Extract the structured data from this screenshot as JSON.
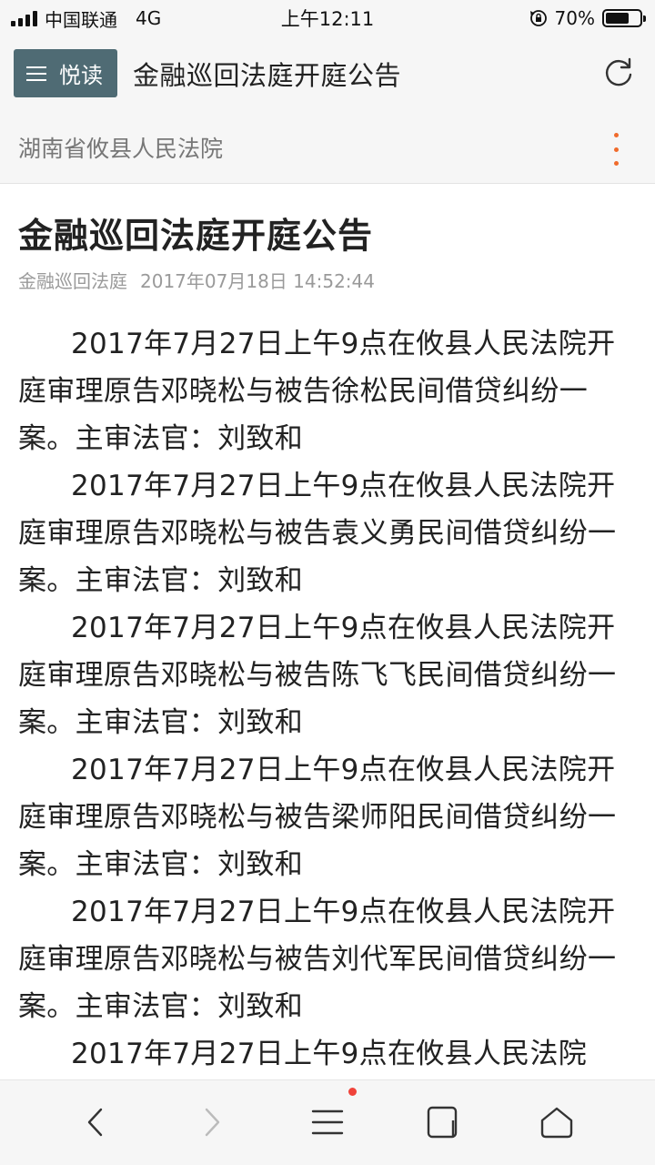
{
  "status_bar": {
    "carrier": "中国联通",
    "network": "4G",
    "time": "上午12:11",
    "battery_percent": "70%",
    "battery_level": 0.7,
    "icons": [
      "signal-icon",
      "rotation-lock-icon",
      "battery-icon"
    ]
  },
  "header": {
    "menu_label": "悦读",
    "title": "金融巡回法庭开庭公告",
    "menu_color": "#4f6b74",
    "icons": [
      "hamburger-icon",
      "refresh-icon"
    ]
  },
  "source": {
    "name": "湖南省攸县人民法院",
    "accent_color": "#f06a2b",
    "icons": [
      "more-vertical-icon"
    ]
  },
  "article": {
    "title": "金融巡回法庭开庭公告",
    "meta_source": "金融巡回法庭",
    "meta_datetime": "2017年07月18日 14:52:44",
    "paragraphs": [
      "2017年7月27日上午9点在攸县人民法院开庭审理原告邓晓松与被告徐松民间借贷纠纷一案。主审法官：刘致和",
      "2017年7月27日上午9点在攸县人民法院开庭审理原告邓晓松与被告袁义勇民间借贷纠纷一案。主审法官：刘致和",
      "2017年7月27日上午9点在攸县人民法院开庭审理原告邓晓松与被告陈飞飞民间借贷纠纷一案。主审法官：刘致和",
      "2017年7月27日上午9点在攸县人民法院开庭审理原告邓晓松与被告梁师阳民间借贷纠纷一案。主审法官：刘致和",
      "2017年7月27日上午9点在攸县人民法院开庭审理原告邓晓松与被告刘代军民间借贷纠纷一案。主审法官：刘致和",
      "2017年7月27日上午9点在攸县人民法院"
    ]
  },
  "bottom_nav": {
    "icons": [
      "back-icon",
      "forward-icon",
      "menu-icon",
      "tabs-icon",
      "home-icon"
    ],
    "notification_color": "#f0433a"
  }
}
